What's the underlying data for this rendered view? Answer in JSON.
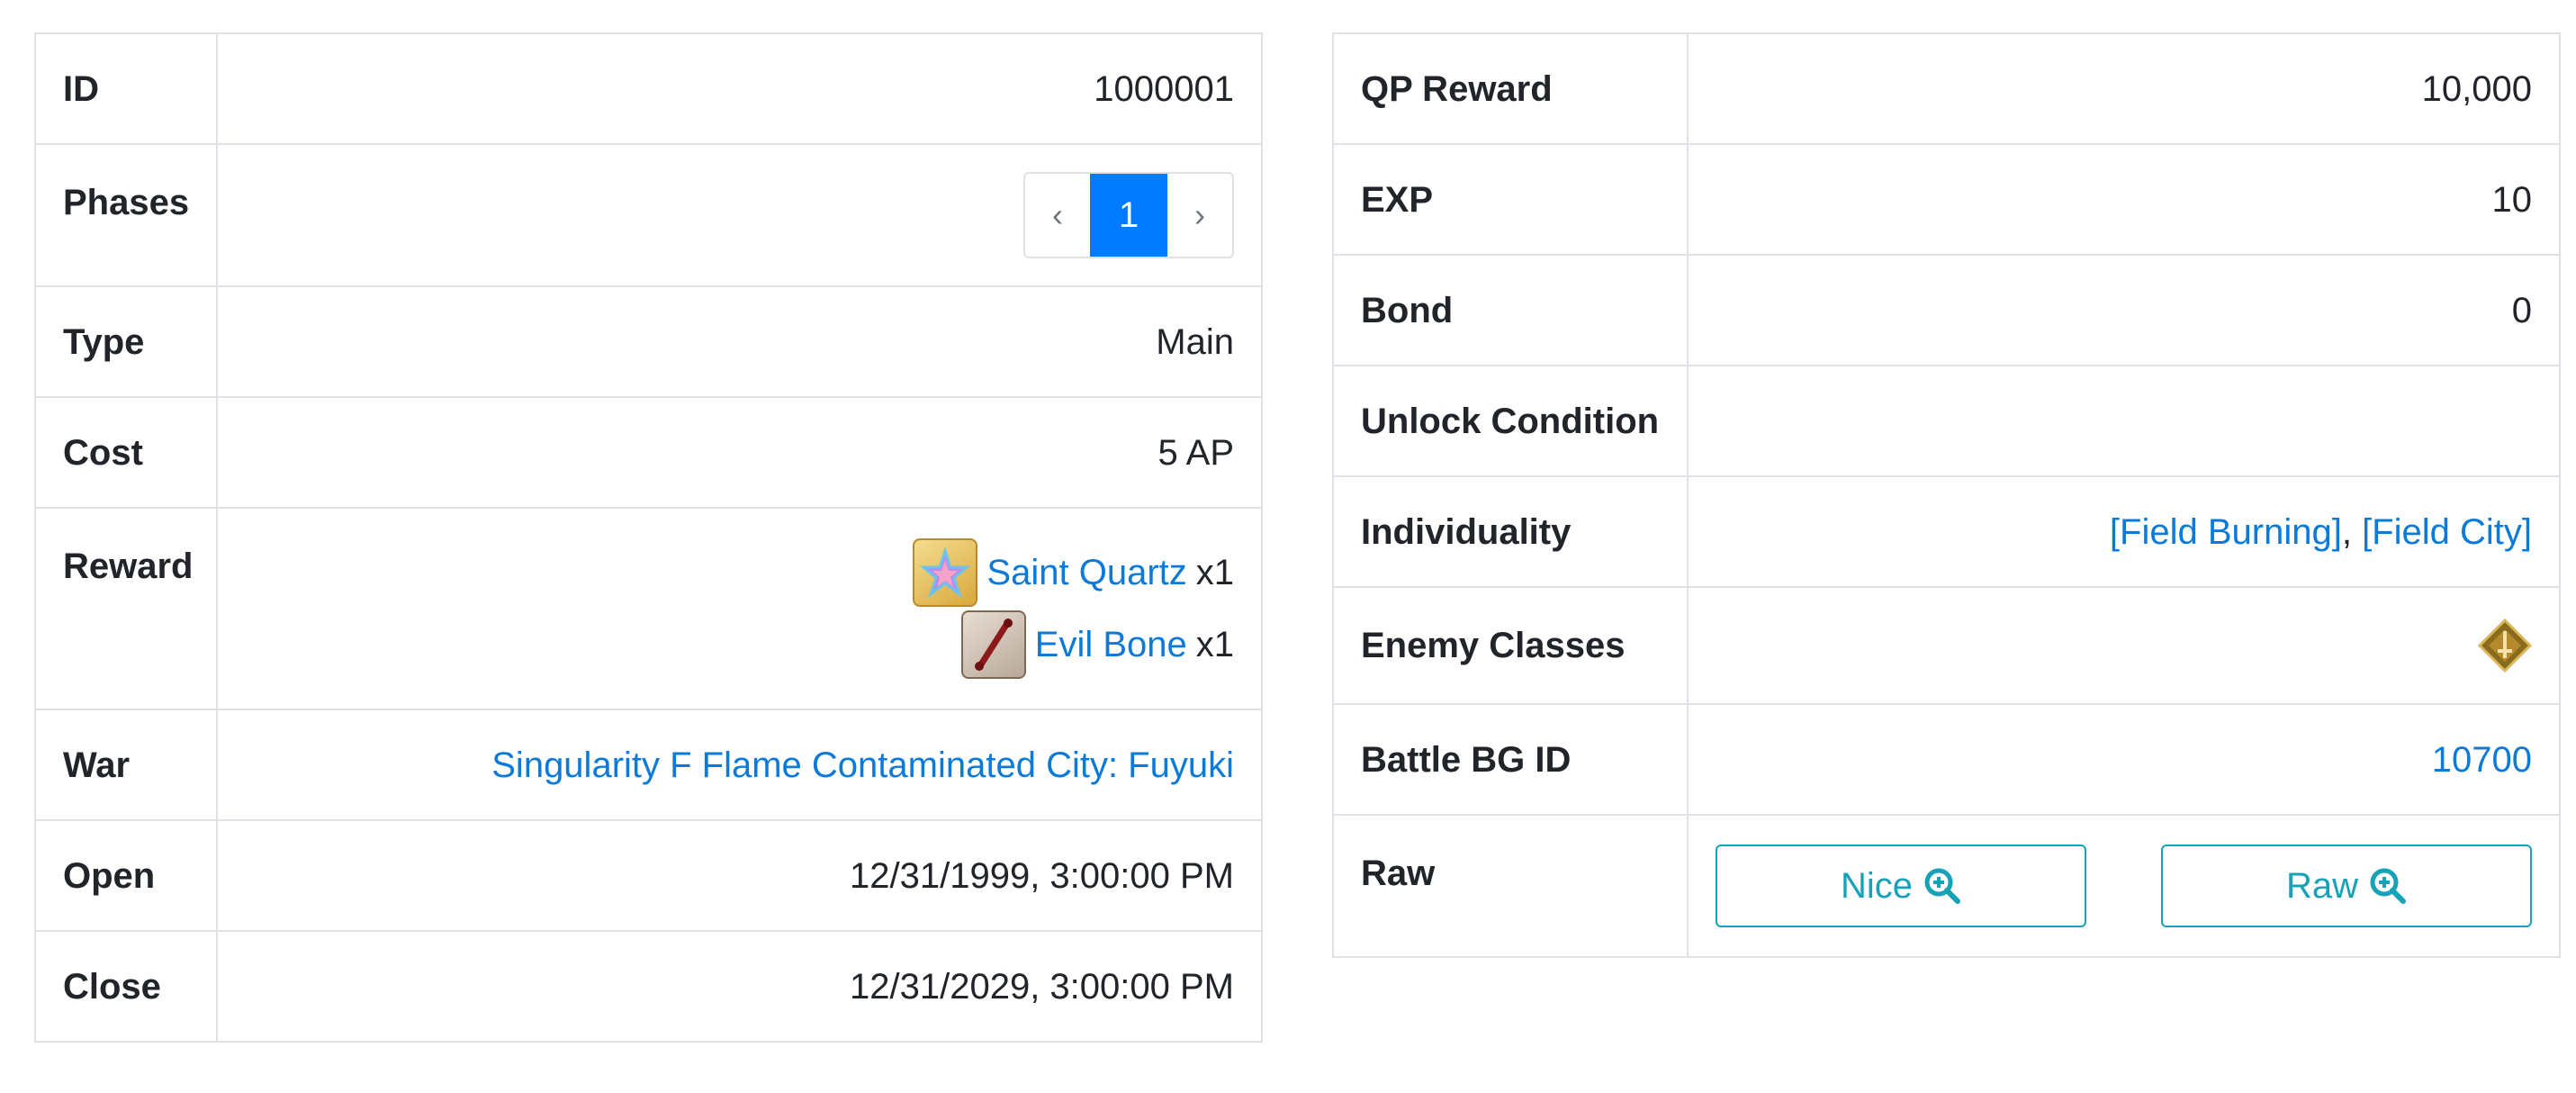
{
  "left": {
    "rows": {
      "id": {
        "label": "ID",
        "value": "1000001"
      },
      "phases": {
        "label": "Phases",
        "prev": "‹",
        "current": "1",
        "next": "›"
      },
      "type": {
        "label": "Type",
        "value": "Main"
      },
      "cost": {
        "label": "Cost",
        "value": "5 AP"
      },
      "reward": {
        "label": "Reward",
        "items": [
          {
            "name": "Saint Quartz",
            "qty": "x1",
            "icon": "saint-quartz-icon"
          },
          {
            "name": "Evil Bone",
            "qty": "x1",
            "icon": "evil-bone-icon"
          }
        ]
      },
      "war": {
        "label": "War",
        "value": "Singularity F Flame Contaminated City: Fuyuki"
      },
      "open": {
        "label": "Open",
        "value": "12/31/1999, 3:00:00 PM"
      },
      "close": {
        "label": "Close",
        "value": "12/31/2029, 3:00:00 PM"
      }
    }
  },
  "right": {
    "rows": {
      "qp": {
        "label": "QP Reward",
        "value": "10,000"
      },
      "exp": {
        "label": "EXP",
        "value": "10"
      },
      "bond": {
        "label": "Bond",
        "value": "0"
      },
      "unlock": {
        "label": "Unlock Condition",
        "value": ""
      },
      "individuality": {
        "label": "Individuality",
        "first": "[Field Burning]",
        "sep": ", ",
        "second": "[Field City]"
      },
      "enemy_classes": {
        "label": "Enemy Classes",
        "icon": "saber-class-icon"
      },
      "battle_bg": {
        "label": "Battle BG ID",
        "value": "10700"
      },
      "raw": {
        "label": "Raw",
        "nice_button": "Nice",
        "raw_button": "Raw"
      }
    }
  },
  "colors": {
    "link": "#0b7ad9",
    "pager_active": "#007bff",
    "button_outline": "#17a2b8",
    "border": "#dee2e6"
  }
}
